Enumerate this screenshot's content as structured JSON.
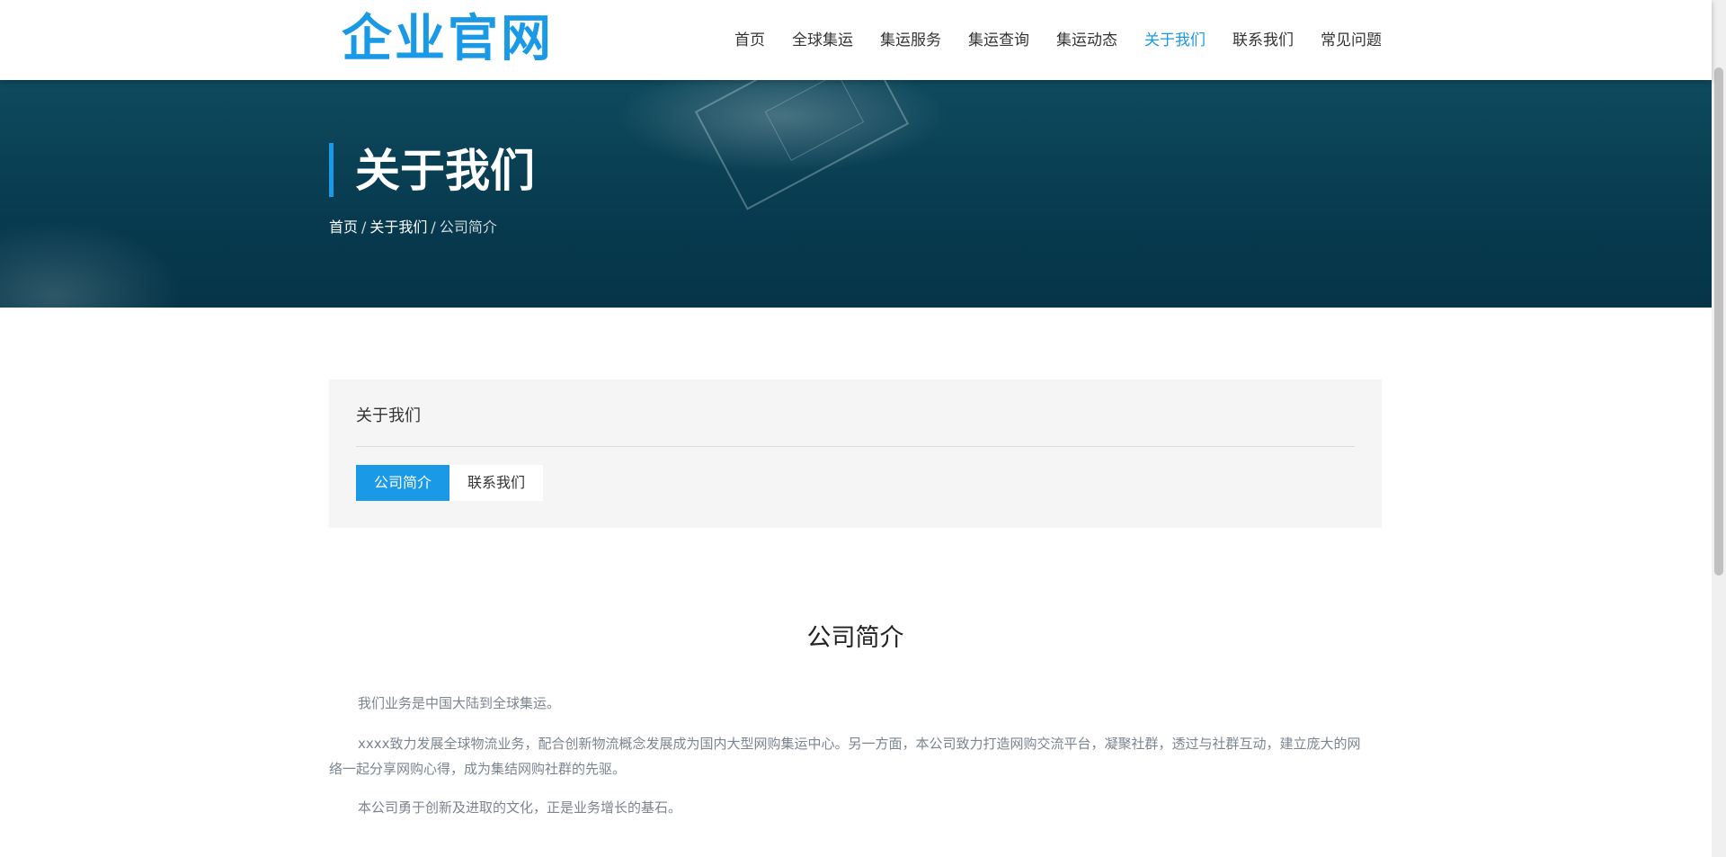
{
  "header": {
    "logo": "企业官网",
    "nav": [
      {
        "label": "首页",
        "active": false
      },
      {
        "label": "全球集运",
        "active": false
      },
      {
        "label": "集运服务",
        "active": false
      },
      {
        "label": "集运查询",
        "active": false
      },
      {
        "label": "集运动态",
        "active": false
      },
      {
        "label": "关于我们",
        "active": true
      },
      {
        "label": "联系我们",
        "active": false
      },
      {
        "label": "常见问题",
        "active": false
      }
    ]
  },
  "banner": {
    "title": "关于我们",
    "breadcrumb": {
      "home": "首页",
      "separator": "/",
      "section": "关于我们",
      "current": "公司简介"
    }
  },
  "subnav": {
    "title": "关于我们",
    "tabs": [
      {
        "label": "公司简介",
        "active": true
      },
      {
        "label": "联系我们",
        "active": false
      }
    ]
  },
  "content": {
    "title": "公司简介",
    "paragraphs": [
      "我们业务是中国大陆到全球集运。",
      "xxxx致力发展全球物流业务，配合创新物流概念发展成为国内大型网购集运中心。另一方面，本公司致力打造网购交流平台，凝聚社群，透过与社群互动，建立庞大的网络一起分享网购心得，成为集结网购社群的先驱。",
      "本公司勇于创新及进取的文化，正是业务增长的基石。"
    ]
  },
  "colors": {
    "accent": "#1a9ae6",
    "banner": "#073a4f",
    "panel": "#f5f5f5",
    "body_text": "#7a8590"
  }
}
